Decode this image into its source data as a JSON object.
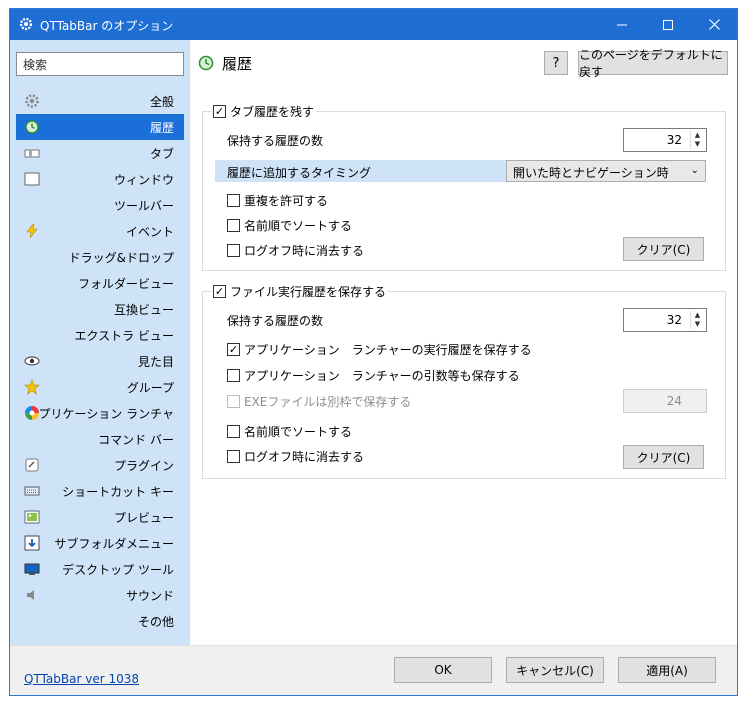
{
  "window": {
    "title": "QTTabBar のオプション"
  },
  "search": {
    "placeholder": "検索"
  },
  "sidebar": {
    "items": [
      {
        "label": "全般",
        "icon": "gear-icon"
      },
      {
        "label": "履歴",
        "icon": "history-icon",
        "active": true
      },
      {
        "label": "タブ",
        "icon": "tab-icon"
      },
      {
        "label": "ウィンドウ",
        "icon": "window-icon"
      },
      {
        "label": "ツールバー",
        "icon": ""
      },
      {
        "label": "イベント",
        "icon": "lightning-icon"
      },
      {
        "label": "ドラッグ&ドロップ",
        "icon": ""
      },
      {
        "label": "フォルダービュー",
        "icon": ""
      },
      {
        "label": "互換ビュー",
        "icon": ""
      },
      {
        "label": "エクストラ ビュー",
        "icon": ""
      },
      {
        "label": "見た目",
        "icon": "eye-icon"
      },
      {
        "label": "グループ",
        "icon": "star-icon"
      },
      {
        "label": "アプリケーション ランチャ",
        "icon": "launcher-icon"
      },
      {
        "label": "コマンド バー",
        "icon": ""
      },
      {
        "label": "プラグイン",
        "icon": "plugin-icon"
      },
      {
        "label": "ショートカット キー",
        "icon": "keyboard-icon"
      },
      {
        "label": "プレビュー",
        "icon": "preview-icon"
      },
      {
        "label": "サブフォルダメニュー",
        "icon": "subfolder-icon"
      },
      {
        "label": "デスクトップ ツール",
        "icon": "desktop-icon"
      },
      {
        "label": "サウンド",
        "icon": "speaker-icon"
      },
      {
        "label": "その他",
        "icon": ""
      }
    ]
  },
  "page": {
    "title": "履歴",
    "help_label": "?",
    "reset_label": "このページをデフォルトに戻す"
  },
  "tab_history": {
    "group_label": "タブ履歴を残す",
    "group_checked": true,
    "count_label": "保持する履歴の数",
    "count_value": "32",
    "timing_label": "履歴に追加するタイミング",
    "timing_value": "開いた時とナビゲーション時",
    "allow_dup_label": "重複を許可する",
    "sort_label": "名前順でソートする",
    "logoff_clear_label": "ログオフ時に消去する",
    "clear_button": "クリア(C)"
  },
  "file_history": {
    "group_label": "ファイル実行履歴を保存する",
    "group_checked": true,
    "count_label": "保持する履歴の数",
    "count_value": "32",
    "launcher_history_label": "アプリケーション　ランチャーの実行履歴を保存する",
    "launcher_history_checked": true,
    "launcher_args_label": "アプリケーション　ランチャーの引数等も保存する",
    "exe_separate_label": "EXEファイルは別枠で保存する",
    "exe_value": "24",
    "sort_label": "名前順でソートする",
    "logoff_clear_label": "ログオフ時に消去する",
    "clear_button": "クリア(C)"
  },
  "footer": {
    "version": "QTTabBar ver 1038",
    "ok": "OK",
    "cancel": "キャンセル(C)",
    "apply": "適用(A)"
  },
  "colors": {
    "titlebar": "#1e6ed4",
    "sidebar_bg": "#cfe3f8",
    "selected": "#1a6fd9"
  }
}
